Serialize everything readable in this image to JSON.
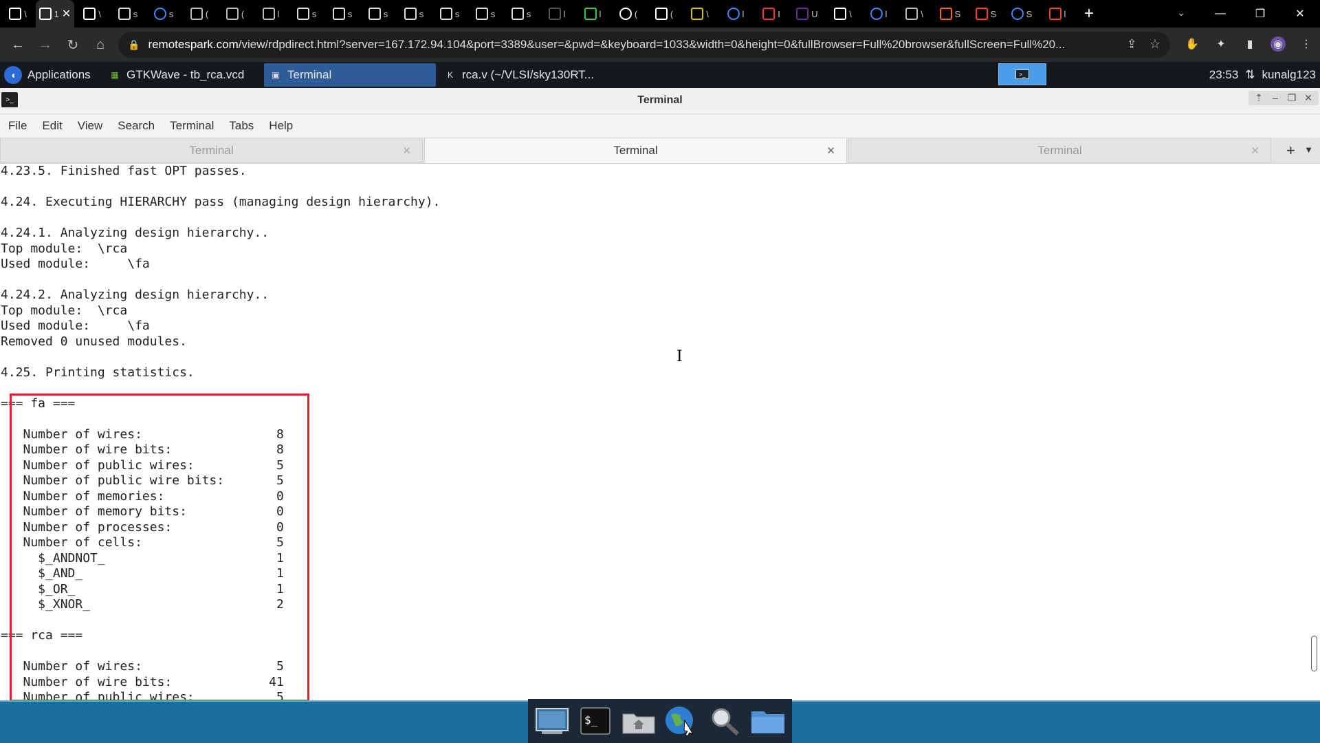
{
  "browser": {
    "tabs": [
      {
        "title": "\\",
        "active": false
      },
      {
        "title": "1",
        "active": true
      },
      {
        "title": "\\",
        "active": false
      },
      {
        "title": "s",
        "active": false
      },
      {
        "title": "s",
        "active": false
      },
      {
        "title": "(",
        "active": false
      },
      {
        "title": "(",
        "active": false
      },
      {
        "title": "l",
        "active": false
      },
      {
        "title": "s",
        "active": false
      },
      {
        "title": "s",
        "active": false
      },
      {
        "title": "s",
        "active": false
      },
      {
        "title": "s",
        "active": false
      },
      {
        "title": "s",
        "active": false
      },
      {
        "title": "s",
        "active": false
      },
      {
        "title": "s",
        "active": false
      },
      {
        "title": "l",
        "active": false
      },
      {
        "title": "l",
        "active": false
      },
      {
        "title": "(",
        "active": false
      },
      {
        "title": "(",
        "active": false
      },
      {
        "title": "\\",
        "active": false
      },
      {
        "title": "l",
        "active": false
      },
      {
        "title": "I",
        "active": false
      },
      {
        "title": "U",
        "active": false
      },
      {
        "title": "\\",
        "active": false
      },
      {
        "title": "l",
        "active": false
      },
      {
        "title": "\\",
        "active": false
      },
      {
        "title": "S",
        "active": false
      },
      {
        "title": "S",
        "active": false
      },
      {
        "title": "S",
        "active": false
      },
      {
        "title": "l",
        "active": false
      }
    ],
    "url_host": "remotespark.com",
    "url_path": "/view/rdpdirect.html?server=167.172.94.104&port=3389&user=&pwd=&keyboard=1033&width=0&height=0&fullBrowser=Full%20browser&fullScreen=Full%20..."
  },
  "panel": {
    "applications_label": "Applications",
    "tasks": [
      {
        "label": "GTKWave - tb_rca.vcd",
        "active": false,
        "icon": "gtkwave-icon"
      },
      {
        "label": "Terminal",
        "active": true,
        "icon": "terminal-icon"
      },
      {
        "label": "rca.v (~/VLSI/sky130RT...",
        "active": false,
        "icon": "editor-icon"
      }
    ],
    "clock": "23:53",
    "user": "kunalg123"
  },
  "terminal": {
    "window_title": "Terminal",
    "menu": [
      "File",
      "Edit",
      "View",
      "Search",
      "Terminal",
      "Tabs",
      "Help"
    ],
    "tabs": [
      {
        "label": "Terminal",
        "active": false
      },
      {
        "label": "Terminal",
        "active": true
      },
      {
        "label": "Terminal",
        "active": false
      }
    ],
    "lines": [
      "4.23.5. Finished fast OPT passes.",
      "",
      "4.24. Executing HIERARCHY pass (managing design hierarchy).",
      "",
      "4.24.1. Analyzing design hierarchy..",
      "Top module:  \\rca",
      "Used module:     \\fa",
      "",
      "4.24.2. Analyzing design hierarchy..",
      "Top module:  \\rca",
      "Used module:     \\fa",
      "Removed 0 unused modules.",
      "",
      "4.25. Printing statistics.",
      "",
      "=== fa ===",
      "",
      "   Number of wires:                  8",
      "   Number of wire bits:              8",
      "   Number of public wires:           5",
      "   Number of public wire bits:       5",
      "   Number of memories:               0",
      "   Number of memory bits:            0",
      "   Number of processes:              0",
      "   Number of cells:                  5",
      "     $_ANDNOT_                       1",
      "     $_AND_                          1",
      "     $_OR_                           1",
      "     $_XNOR_                         2",
      "",
      "=== rca ===",
      "",
      "   Number of wires:                  5",
      "   Number of wire bits:             41",
      "   Number of public wires:           5"
    ]
  },
  "dock": {
    "items": [
      "desktop-icon",
      "terminal-icon",
      "home-folder-icon",
      "web-browser-icon",
      "search-icon",
      "files-icon"
    ]
  },
  "colors": {
    "highlight_box": "#e0212b",
    "panel_bg": "#15181c",
    "active_task": "#2d5c97",
    "dock_bar": "#1a6f9c"
  }
}
